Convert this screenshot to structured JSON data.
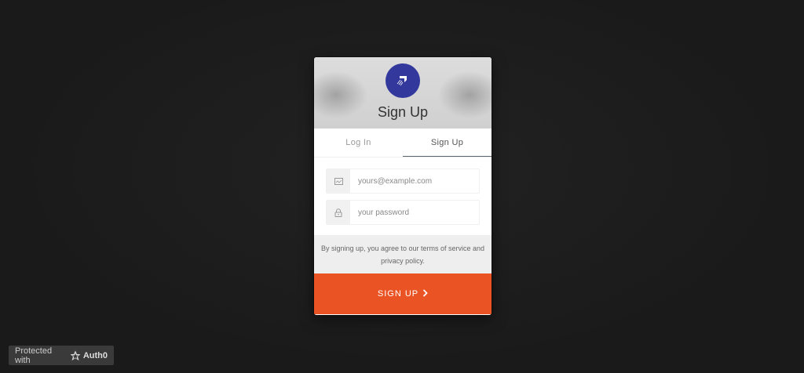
{
  "header": {
    "title": "Sign Up",
    "logo_icon": "boomerang-icon",
    "logo_color": "#33399c"
  },
  "tabs": [
    {
      "label": "Log In",
      "active": false
    },
    {
      "label": "Sign Up",
      "active": true
    }
  ],
  "form": {
    "email": {
      "placeholder": "yours@example.com",
      "value": "",
      "icon": "email-icon"
    },
    "password": {
      "placeholder": "your password",
      "value": "",
      "icon": "lock-icon"
    }
  },
  "terms_text": "By signing up, you agree to our terms of service and privacy policy.",
  "submit": {
    "label": "SIGN UP",
    "icon": "chevron-right-icon",
    "color": "#ea5323"
  },
  "badge": {
    "prefix": "Protected with",
    "brand": "Auth0",
    "icon": "auth0-star-icon"
  }
}
